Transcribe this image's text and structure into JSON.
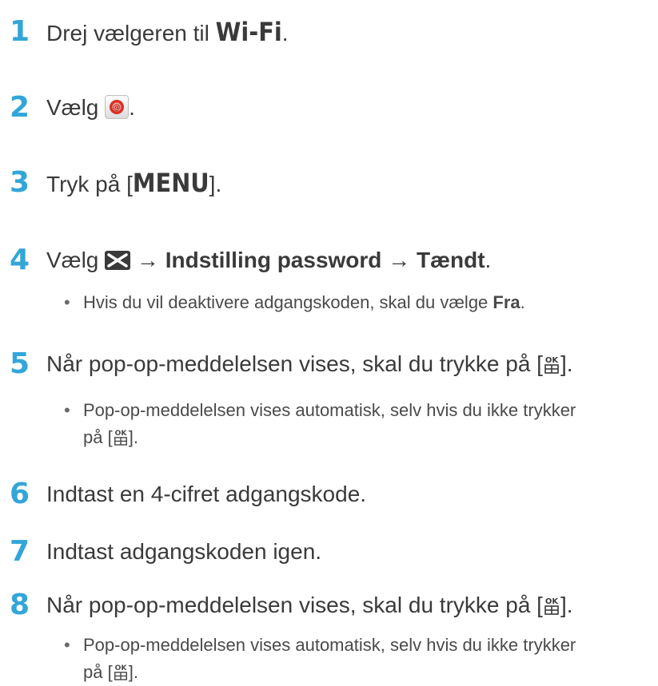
{
  "steps": [
    {
      "number": "1",
      "text_before": "Drej vælgeren til ",
      "mode": "Wi-Fi",
      "text_after": "."
    },
    {
      "number": "2",
      "text_before": "Vælg ",
      "icon": "email-app-icon",
      "text_after": "."
    },
    {
      "number": "3",
      "text_before": "Tryk på [",
      "key": "MENU",
      "text_after": "]."
    },
    {
      "number": "4",
      "text_before": "Vælg ",
      "icon": "envelope-icon",
      "arrow1": " → ",
      "option1": "Indstilling password",
      "arrow2": " → ",
      "option2": "Tændt",
      "text_after": ".",
      "note_before": "Hvis du vil deaktivere adgangskoden, skal du vælge ",
      "note_option": "Fra",
      "note_after": "."
    },
    {
      "number": "5",
      "text_before": "Når pop-op-meddelelsen vises, skal du trykke på [",
      "icon": "ok-button-icon",
      "text_after": "].",
      "note_line1": "Pop-op-meddelelsen vises automatisk, selv hvis du ikke trykker",
      "note_line2_before": "på [",
      "note_line2_after": "]."
    },
    {
      "number": "6",
      "text": "Indtast en 4-cifret adgangskode."
    },
    {
      "number": "7",
      "text": "Indtast adgangskoden igen."
    },
    {
      "number": "8",
      "text_before": "Når pop-op-meddelelsen vises, skal du trykke på [",
      "icon": "ok-button-icon",
      "text_after": "].",
      "note_line1": "Pop-op-meddelelsen vises automatisk, selv hvis du ikke trykker",
      "note_line2_before": "på [",
      "note_line2_after": "]."
    }
  ],
  "bullet_symbol": "•",
  "colors": {
    "step_number": "#33a6d8",
    "body_text": "#3a3a3a"
  }
}
